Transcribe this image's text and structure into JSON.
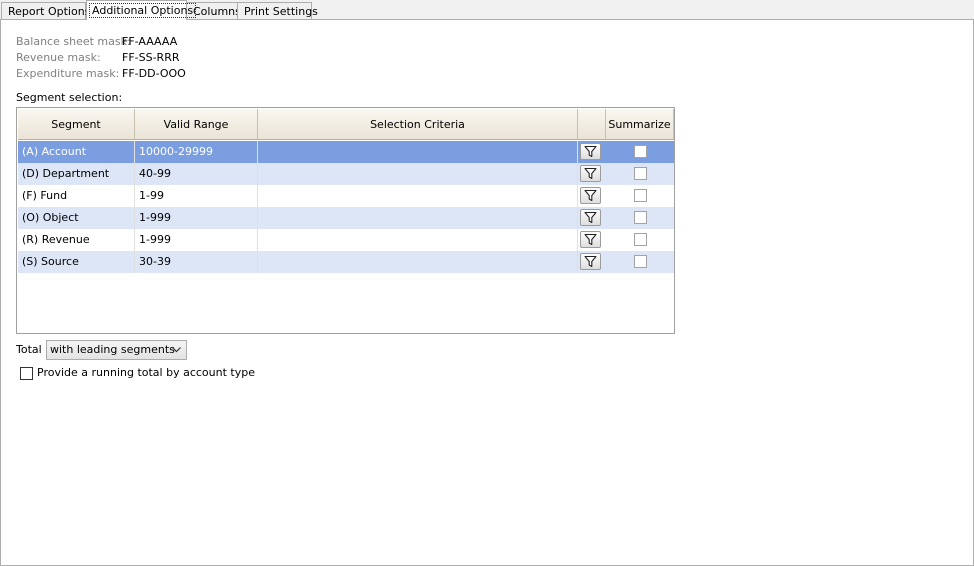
{
  "tabs": [
    {
      "label": "Report Options"
    },
    {
      "label": "Additional Options"
    },
    {
      "label": "Columns"
    },
    {
      "label": "Print Settings"
    }
  ],
  "masks": {
    "balance_label": "Balance sheet mask:",
    "balance_value": "FF-AAAAA",
    "revenue_label": "Revenue mask:",
    "revenue_value": "FF-SS-RRR",
    "expenditure_label": "Expenditure mask:",
    "expenditure_value": "FF-DD-OOO"
  },
  "segment_selection_label": "Segment selection:",
  "grid": {
    "headers": {
      "segment": "Segment",
      "valid_range": "Valid Range",
      "criteria": "Selection Criteria",
      "filter": "",
      "summarize": "Summarize"
    },
    "rows": [
      {
        "segment": "(A) Account",
        "valid_range": "10000-29999",
        "criteria": "",
        "summarize": false
      },
      {
        "segment": "(D) Department",
        "valid_range": "40-99",
        "criteria": "",
        "summarize": false
      },
      {
        "segment": "(F) Fund",
        "valid_range": "1-99",
        "criteria": "",
        "summarize": false
      },
      {
        "segment": "(O) Object",
        "valid_range": "1-999",
        "criteria": "",
        "summarize": false
      },
      {
        "segment": "(R) Revenue",
        "valid_range": "1-999",
        "criteria": "",
        "summarize": false
      },
      {
        "segment": "(S) Source",
        "valid_range": "30-39",
        "criteria": "",
        "summarize": false
      }
    ],
    "selected_row_color": "#7b9ee0",
    "alt_row_color": "#dce6f7",
    "filter_icon": "funnel-icon"
  },
  "total": {
    "label": "Total",
    "value": "with leading segments"
  },
  "running_total": {
    "label": "Provide a running total by account type",
    "checked": false
  }
}
